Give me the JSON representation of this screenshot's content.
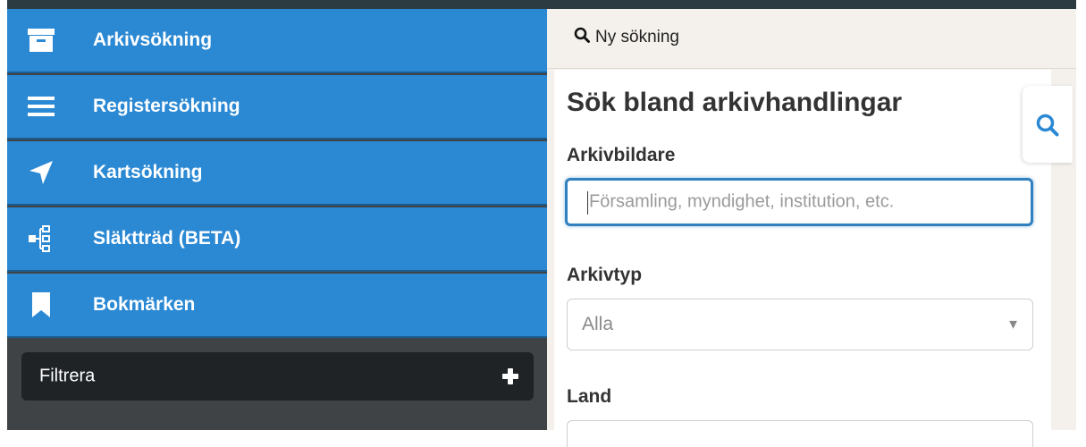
{
  "sidebar": {
    "items": [
      {
        "label": "Arkivsökning",
        "icon": "archive-box-icon"
      },
      {
        "label": "Registersökning",
        "icon": "list-icon"
      },
      {
        "label": "Kartsökning",
        "icon": "location-arrow-icon"
      },
      {
        "label": "Släktträd (BETA)",
        "icon": "family-tree-icon"
      },
      {
        "label": "Bokmärken",
        "icon": "bookmark-icon"
      }
    ],
    "filter": {
      "label": "Filtrera",
      "icon": "plus-icon"
    }
  },
  "toolbar": {
    "new_search_label": "Ny sökning",
    "new_search_icon": "search-icon"
  },
  "panel": {
    "title": "Sök bland arkivhandlingar",
    "creator": {
      "label": "Arkivbildare",
      "value": "",
      "placeholder": "Församling, myndighet, institution, etc."
    },
    "type": {
      "label": "Arkivtyp",
      "selected": "Alla"
    },
    "country": {
      "label": "Land",
      "selected": ""
    }
  },
  "side_search_tab": {
    "icon": "search-icon"
  },
  "colors": {
    "nav_blue": "#2b89d4",
    "sidebar_dark": "#3f4346",
    "filter_dark": "#1f2326",
    "focus_blue": "#3180bf",
    "right_bg": "#f4f1ec",
    "search_icon_blue": "#2b89d4"
  }
}
